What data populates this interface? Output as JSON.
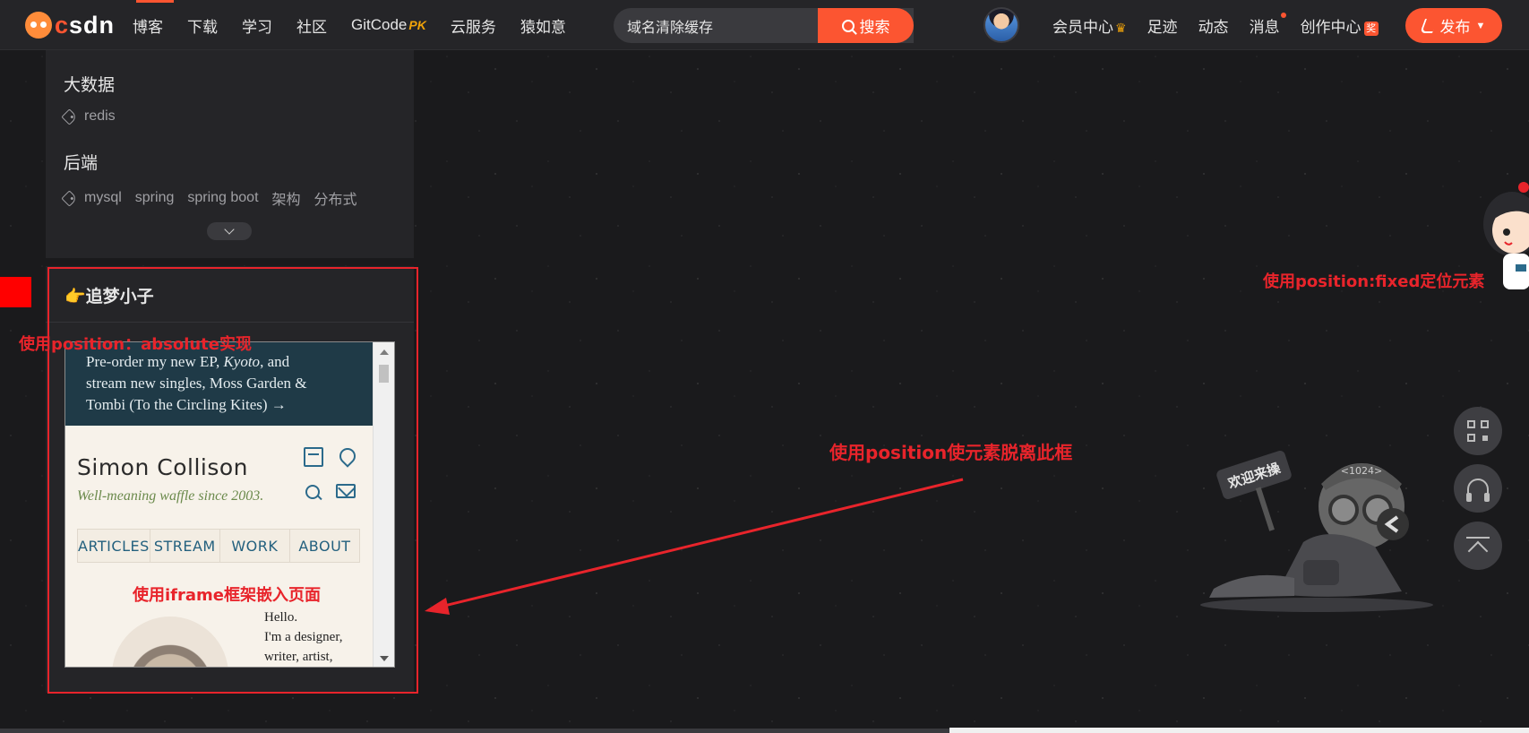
{
  "header": {
    "logo_text": "CSDN",
    "nav": [
      {
        "label": "博客"
      },
      {
        "label": "下载"
      },
      {
        "label": "学习"
      },
      {
        "label": "社区"
      },
      {
        "label": "GitCode",
        "badge": "PK"
      },
      {
        "label": "云服务"
      },
      {
        "label": "猿如意"
      }
    ],
    "search": {
      "value": "域名清除缓存",
      "button_label": "搜索"
    },
    "right": [
      {
        "label": "会员中心"
      },
      {
        "label": "足迹"
      },
      {
        "label": "动态"
      },
      {
        "label": "消息"
      },
      {
        "label": "创作中心",
        "badge": "奖"
      }
    ],
    "publish_label": "发布",
    "colors": {
      "accent": "#fc5531",
      "bar": "#252528"
    }
  },
  "tag_panel": {
    "groups": [
      {
        "title": "大数据",
        "tags": [
          "redis"
        ]
      },
      {
        "title": "后端",
        "tags": [
          "mysql",
          "spring",
          "spring boot",
          "架构",
          "分布式"
        ]
      }
    ]
  },
  "author": {
    "name": "追梦小子",
    "emoji": "👉"
  },
  "iframe": {
    "banner_line1": "Pre-order my new EP, ",
    "banner_em": "Kyoto",
    "banner_line1_end": ", and",
    "banner_line2": "stream new singles, Moss Garden &",
    "banner_line3": "Tombi (To the Circling Kites) →",
    "site_title": "Simon Collison",
    "site_subtitle": "Well-meaning waffle since 2003.",
    "nav": [
      "ARTICLES",
      "STREAM",
      "WORK",
      "ABOUT"
    ],
    "hello_lines": [
      "Hello.",
      "I'm a designer,",
      "writer, artist,"
    ]
  },
  "annotations": {
    "absolute": "使用position：absolute实现",
    "iframe": "使用iframe框架嵌入页面",
    "detach": "使用position使元素脱离此框",
    "fixed": "使用position:fixed定位元素",
    "color": "#e8242b"
  },
  "mascot": {
    "sign_text": "欢迎来操",
    "hat_text": "<1024>"
  },
  "side_tools": [
    "qr-code-icon",
    "headset-icon",
    "back-to-top-icon"
  ]
}
